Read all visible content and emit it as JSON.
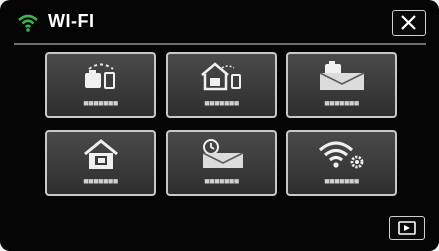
{
  "header": {
    "title": "WI-FI",
    "status_icon": "wifi-icon",
    "status_color": "#3cb24a",
    "close_icon": "close-icon"
  },
  "tiles": [
    {
      "icon": "direct-monitoring-icon",
      "label": "■■■■■■■"
    },
    {
      "icon": "indoor-monitoring-icon",
      "label": "■■■■■■■"
    },
    {
      "icon": "video-mail-icon",
      "label": "■■■■■■■"
    },
    {
      "icon": "home-icon",
      "label": "■■■■■■■"
    },
    {
      "icon": "scheduled-mail-icon",
      "label": "■■■■■■■"
    },
    {
      "icon": "wifi-settings-icon",
      "label": "■■■■■■■"
    }
  ],
  "footer": {
    "playback_icon": "playback-icon"
  }
}
